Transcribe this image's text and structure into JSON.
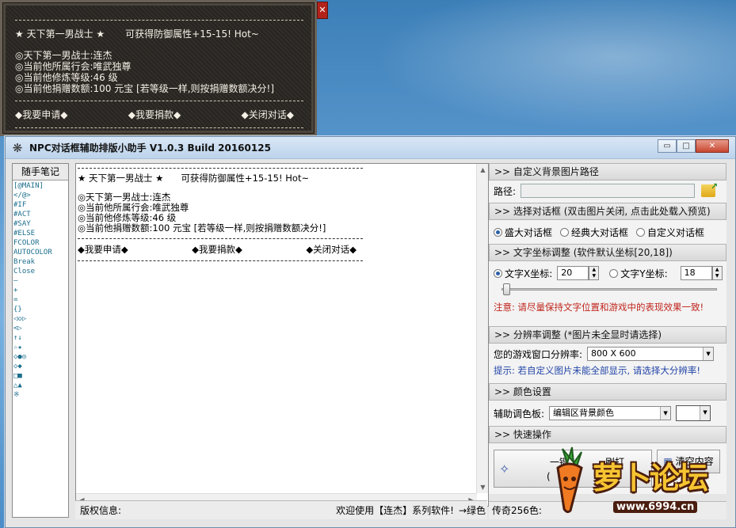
{
  "npc_preview": {
    "close_glyph": "✕",
    "title_left": "★ 天下第一男战士 ★",
    "title_right": "可获得防御属性+15-15! Hot~",
    "lines": [
      "◎天下第一男战士:连杰",
      "◎当前他所属行会:唯武独尊",
      "◎当前他修炼等级:46 级",
      "◎当前他捐赠数额:100 元宝 [若等级一样,则按捐赠数额决分!]"
    ],
    "actions": [
      "◆我要申请◆",
      "◆我要捐款◆",
      "◆关闭对话◆"
    ]
  },
  "app": {
    "logo_glyph": "❋",
    "title": "NPC对话框辅助排版小助手 V1.0.3 Build 20160125",
    "win_buttons": [
      "▭",
      "□",
      "✕"
    ]
  },
  "notes": {
    "header": "随手笔记",
    "items": [
      "[@MAIN]",
      "</@>",
      "#IF",
      "#ACT",
      "#SAY",
      "#ELSE",
      "FCOLOR",
      "AUTOCOLOR",
      "Break",
      "Close",
      "—",
      "+",
      "=",
      "{}",
      "◁◇▷",
      "<▷",
      "↑↓",
      "☆★",
      "◇●◎",
      "◇◆",
      "□■",
      "△▲",
      "※"
    ]
  },
  "editor": {
    "title_left": "★ 天下第一男战士 ★",
    "title_right": "可获得防御属性+15-15! Hot~",
    "lines": [
      "◎天下第一男战士:连杰",
      "◎当前他所属行会:唯武独尊",
      "◎当前他修炼等级:46 级",
      "◎当前他捐赠数额:100 元宝 [若等级一样,则按捐赠数额决分!]"
    ],
    "actions": [
      "◆我要申请◆",
      "◆我要捐款◆",
      "◆关闭对话◆"
    ]
  },
  "status": {
    "copyright": "版权信息:",
    "welcome": "欢迎使用【连杰】系列软件!",
    "arrow": "→绿色"
  },
  "panel": {
    "bg_section": ">> 自定义背景图片路径",
    "path_label": "路径:",
    "dialog_section": ">> 选择对话框 (双击图片关闭, 点击此处载入预览)",
    "dialog_options": [
      "盛大对话框",
      "经典大对话框",
      "自定义对话框"
    ],
    "coord_section": ">> 文字坐标调整 (软件默认坐标[20,18])",
    "x_label": "文字X坐标:",
    "x_value": "20",
    "y_label": "文字Y坐标:",
    "y_value": "18",
    "coord_warning": "注意: 请尽量保持文字位置和游戏中的表现效果一致!",
    "res_section": ">> 分辨率调整 (*图片未全显时请选择)",
    "res_label": "您的游戏窗口分辨率:",
    "res_value": "800 X 600",
    "res_hint": "提示: 若自定义图片未能全部显示, 请选择大分辨率!",
    "color_section": ">> 颜色设置",
    "palette_label": "辅助调色板:",
    "palette_value": "编辑区背景颜色",
    "quick_section": ">> 快速操作",
    "quick_btn1": "一键",
    "quick_btn1b": "(",
    "quick_btn1c": "刷打",
    "quick_btn1d": "最",
    "quick_btn2": "清空内容",
    "bottom_color": "传奇256色:"
  },
  "watermark": {
    "text": "萝卜论坛",
    "url": "www.6994.cn"
  }
}
